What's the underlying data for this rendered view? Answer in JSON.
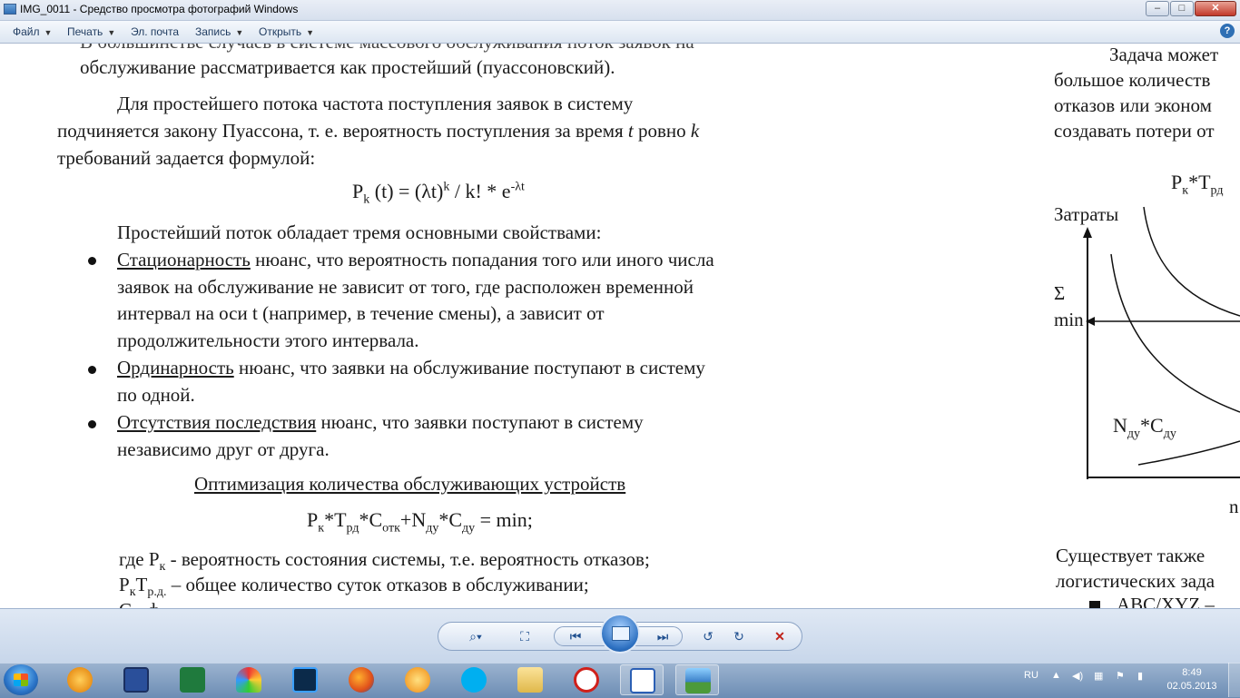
{
  "window": {
    "title": "IMG_0011 - Средство просмотра фотографий Windows",
    "min_label": "–",
    "max_label": "□",
    "close_label": "✕"
  },
  "menu": {
    "items": [
      {
        "label": "Файл",
        "arrow": "▼"
      },
      {
        "label": "Печать",
        "arrow": "▼"
      },
      {
        "label": "Эл. почта",
        "arrow": ""
      },
      {
        "label": "Запись",
        "arrow": "▼"
      },
      {
        "label": "Открыть",
        "arrow": "▼"
      }
    ],
    "help": "?"
  },
  "document": {
    "lines": [
      "В большинстве случаев в системе массового обслуживания поток заявок на",
      "обслуживание рассматривается как простейший (пуассоновский).",
      "Для простейшего потока частота поступления заявок в систему",
      "подчиняется закону Пуассона, т. е. вероятность поступления за время",
      "t",
      "ровно",
      "k",
      "требований задается формулой:"
    ],
    "formula1": {
      "p": "P",
      "k": "k",
      "t": "(t) = (λt)",
      "sup_k": "k",
      "rest": " / k! * e",
      "sup_exp": "-λt"
    },
    "props_intro": "Простейший поток обладает тремя основными свойствами:",
    "bullets": [
      {
        "term": "Стационарность",
        "text": " нюанс, что вероятность попадания того или иного числа",
        "cont": [
          "заявок на обслуживание не зависит от того, где расположен временной",
          "интервал на оси t (например, в течение смены), а зависит от",
          "продолжительности этого интервала."
        ]
      },
      {
        "term": "Ординарность",
        "text": " нюанс, что заявки на обслуживание поступают в систему",
        "cont": [
          "по одной."
        ]
      },
      {
        "term": "Отсутствия последствия",
        "text": " нюанс, что заявки поступают в систему",
        "cont": [
          "независимо друг от друга."
        ]
      }
    ],
    "section_title": "Оптимизация количества обслуживающих устройств",
    "formula2": {
      "a": "P",
      "a_sub": "к",
      "b": "*T",
      "b_sub": "рд",
      "c": "*C",
      "c_sub": "отк",
      "d": "+N",
      "d_sub": "ду",
      "e": "*C",
      "e_sub": "ду",
      "f": " = min;"
    },
    "where1": {
      "pre": "где P",
      "sub": "к",
      "text": " -  вероятность состояния системы, т.е. вероятность отказов;"
    },
    "where2": {
      "a": "P",
      "a_sub": "к",
      "b": "T",
      "b_sub": "р.д.",
      "text": " – общее количество суток отказов в обслуживании;"
    },
    "where3": "C             -                      ф      "
  },
  "right_page": {
    "lines": [
      "Задача может",
      "большое количеств",
      "отказов или эконом",
      "создавать потери от"
    ],
    "chart_title": {
      "a": "P",
      "a_sub": "к",
      "b": "*T",
      "b_sub": "рд"
    },
    "y_label": "Затраты",
    "sigma": "Σ",
    "min": "min",
    "curve_label": {
      "a": "N",
      "a_sub": "ду",
      "b": "*C",
      "b_sub": "ду"
    },
    "x_label": "n",
    "lines2": [
      "Существует также",
      "логистических зада",
      "ABC/XYZ –"
    ]
  },
  "viewer": {
    "zoom": "⌕▾",
    "fit": "⛶",
    "prev": "⏮",
    "next": "⏭",
    "rotl": "↺",
    "rotr": "↻",
    "del": "✕"
  },
  "taskbar": {
    "lang": "RU",
    "time": "8:49",
    "date": "02.05.2013"
  },
  "colors": {
    "accent": "#2f6fb4",
    "delete_red": "#c0231a"
  }
}
